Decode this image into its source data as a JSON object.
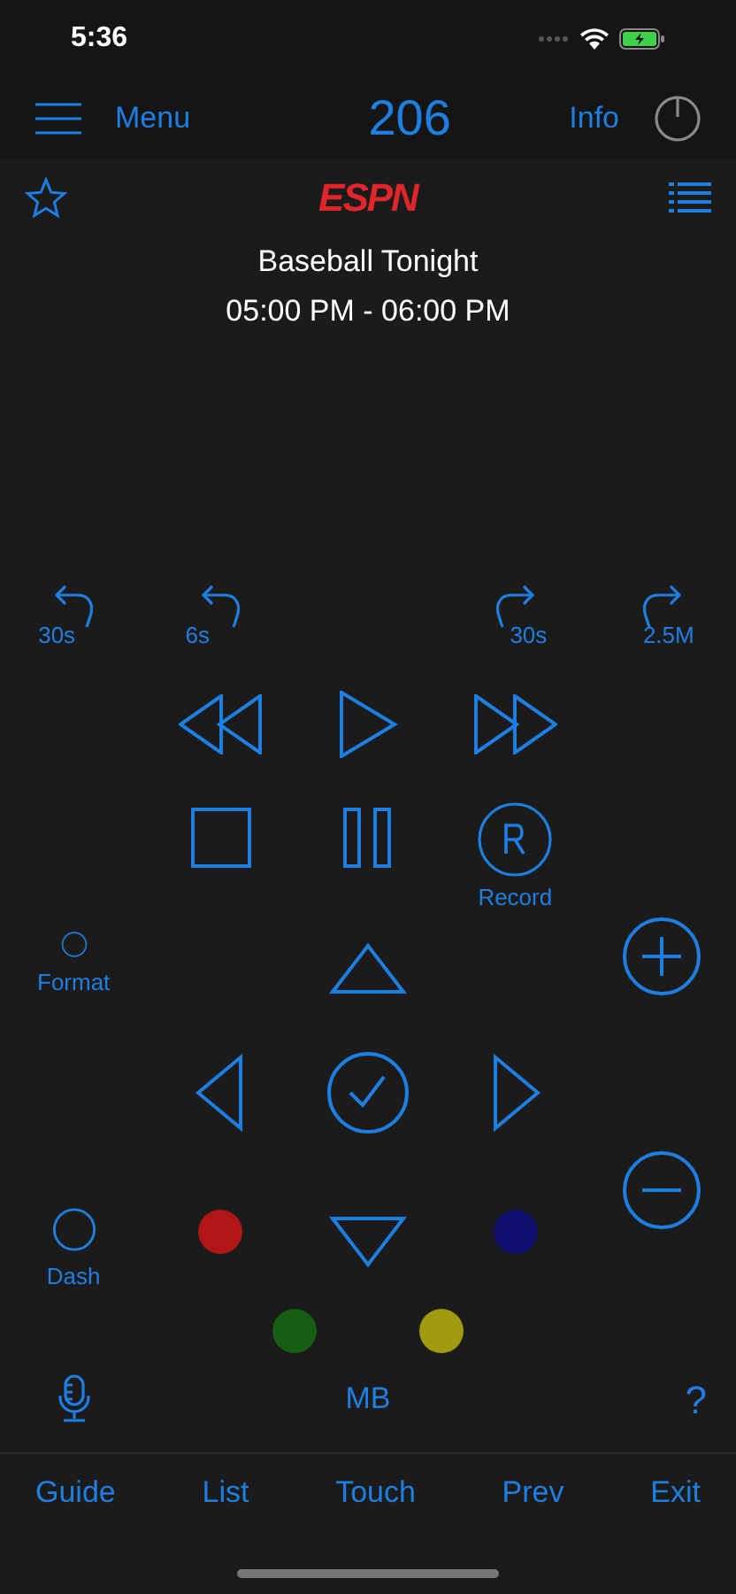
{
  "status_bar": {
    "time": "5:36"
  },
  "header": {
    "menu_label": "Menu",
    "channel": "206",
    "info_label": "Info"
  },
  "program": {
    "logo": "ESPN",
    "title": "Baseball Tonight",
    "time": "05:00 PM - 06:00 PM"
  },
  "skip_buttons": [
    {
      "label": "30s",
      "kind": "back"
    },
    {
      "label": "6s",
      "kind": "back"
    },
    {
      "label": "30s",
      "kind": "forward"
    },
    {
      "label": "2.5M",
      "kind": "forward"
    }
  ],
  "record_label": "Record",
  "format_label": "Format",
  "dash_label": "Dash",
  "color_buttons": [
    {
      "color": "#b01616"
    },
    {
      "color": "#0f0f6e"
    },
    {
      "color": "#155e12"
    },
    {
      "color": "#9f9a10"
    }
  ],
  "mb_label": "MB",
  "help_label": "?",
  "bottom_bar": [
    "Guide",
    "List",
    "Touch",
    "Prev",
    "Exit"
  ]
}
